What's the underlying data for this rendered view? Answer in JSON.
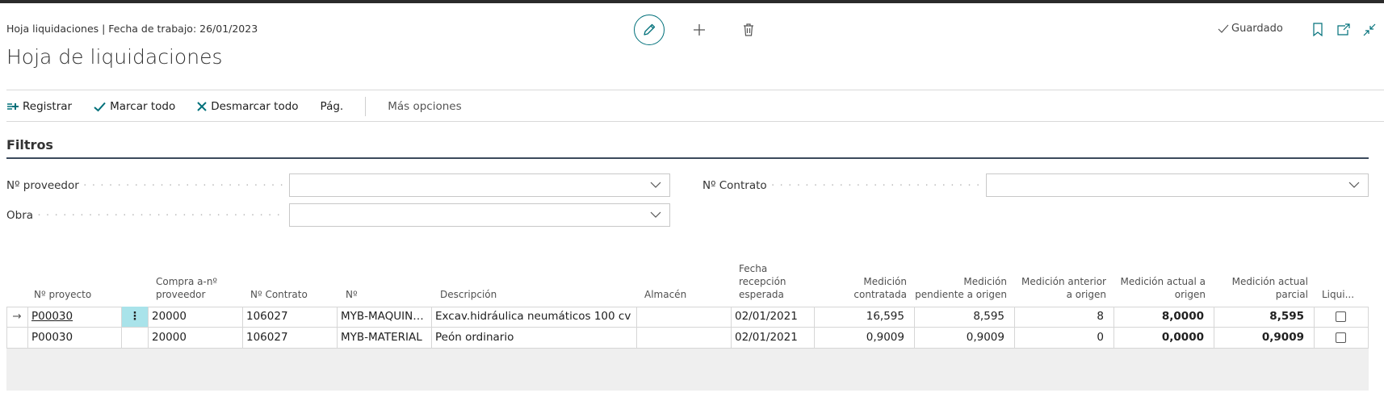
{
  "header": {
    "breadcrumb": "Hoja liquidaciones | Fecha de trabajo: 26/01/2023",
    "title": "Hoja de liquidaciones",
    "saved_label": "Guardado",
    "icons": [
      "pencil-icon",
      "plus-icon",
      "trash-icon",
      "bookmark-icon",
      "open-new-window-icon",
      "collapse-icon"
    ],
    "accent_color": "#00707a"
  },
  "actions": {
    "registrar": "Registrar",
    "marcar_todo": "Marcar todo",
    "desmarcar_todo": "Desmarcar todo",
    "pag": "Pág.",
    "mas_opciones": "Más opciones"
  },
  "filters": {
    "title": "Filtros",
    "proveedor_label": "Nº proveedor",
    "contrato_label": "Nº Contrato",
    "obra_label": "Obra",
    "proveedor_value": "",
    "contrato_value": "",
    "obra_value": ""
  },
  "table": {
    "columns": {
      "proyecto": "Nº proyecto",
      "compra_1": "Compra a-nº",
      "compra_2": "proveedor",
      "contrato": "Nº Contrato",
      "no": "Nº",
      "descripcion": "Descripción",
      "almacen": "Almacén",
      "fecha_1": "Fecha",
      "fecha_2": "recepción",
      "fecha_3": "esperada",
      "med_contratada_1": "Medición",
      "med_contratada_2": "contratada",
      "med_pendiente_1": "Medición",
      "med_pendiente_2": "pendiente a origen",
      "med_anterior_1": "Medición anterior",
      "med_anterior_2": "a origen",
      "med_actual_origen_1": "Medición actual a",
      "med_actual_origen_2": "origen",
      "med_actual_parcial_1": "Medición actual",
      "med_actual_parcial_2": "parcial",
      "liquidar": "Liqui..."
    },
    "rows": [
      {
        "indicator": "→",
        "proyecto": "P00030",
        "menu": "⋮",
        "compra": "20000",
        "contrato": "106027",
        "no": "MYB-MAQUINA...",
        "descripcion": "Excav.hidráulica neumáticos 100 cv",
        "almacen": "",
        "fecha": "02/01/2021",
        "med_contratada": "16,595",
        "med_pendiente": "8,595",
        "med_anterior": "8",
        "med_actual_origen": "8,0000",
        "med_actual_parcial": "8,595",
        "liquidar": false
      },
      {
        "indicator": "",
        "proyecto": "P00030",
        "menu": "",
        "compra": "20000",
        "contrato": "106027",
        "no": "MYB-MATERIAL",
        "descripcion": "Peón ordinario",
        "almacen": "",
        "fecha": "02/01/2021",
        "med_contratada": "0,9009",
        "med_pendiente": "0,9009",
        "med_anterior": "0",
        "med_actual_origen": "0,0000",
        "med_actual_parcial": "0,9009",
        "liquidar": false
      }
    ]
  }
}
